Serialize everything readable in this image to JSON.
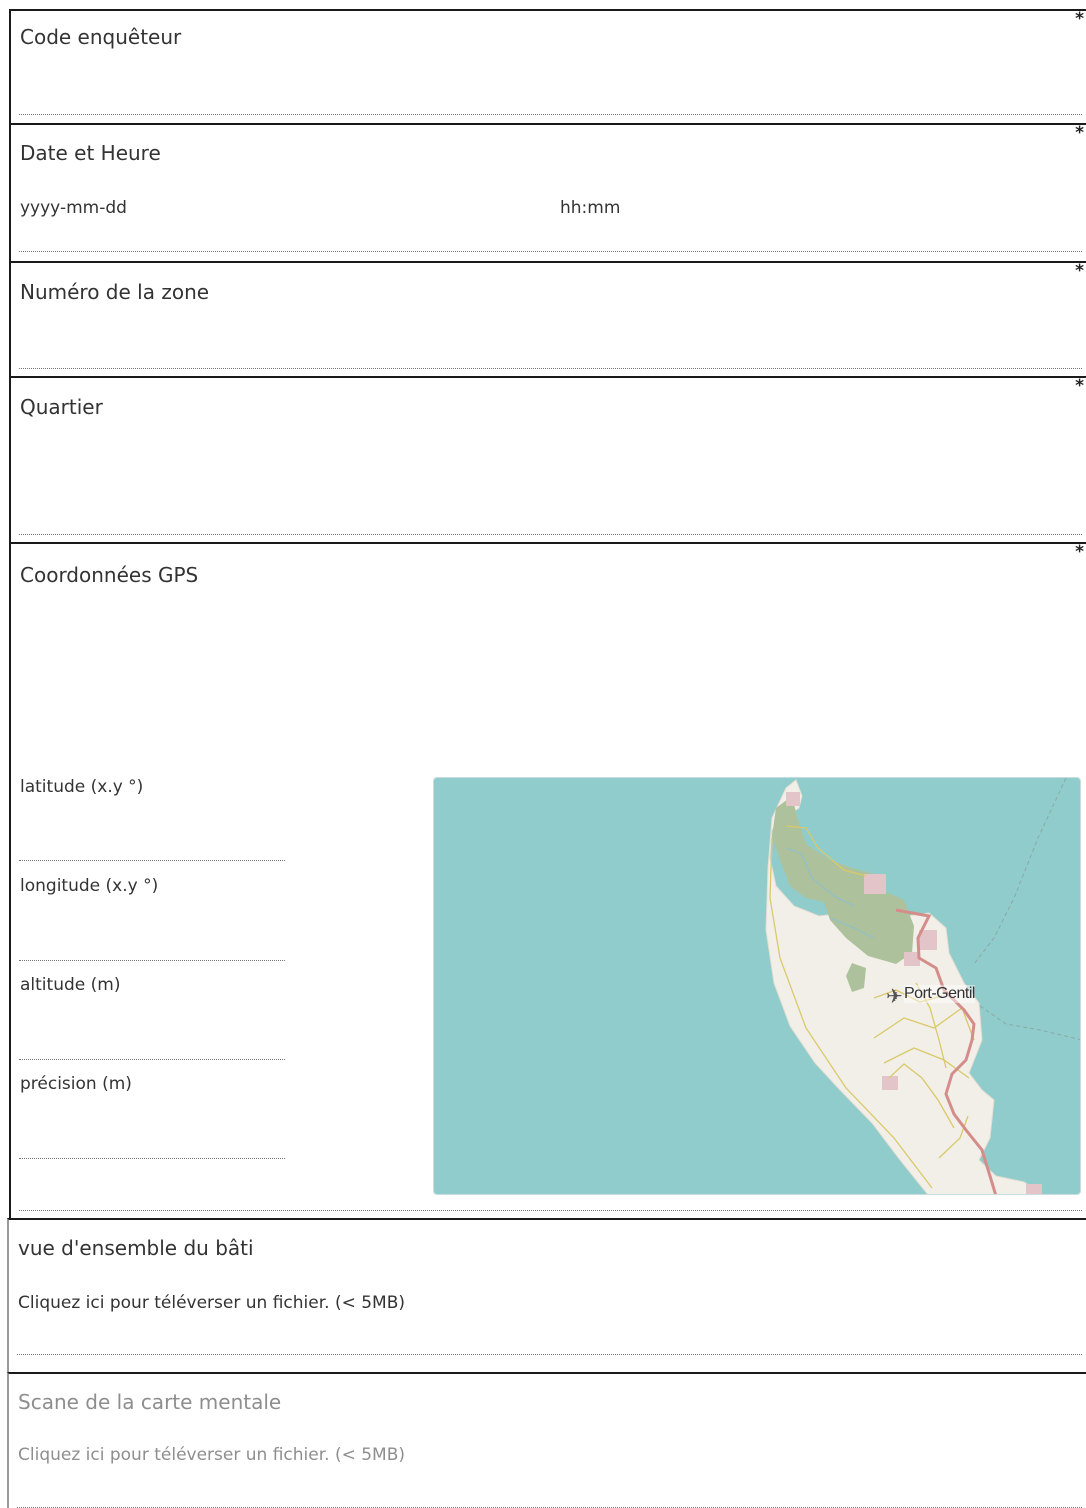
{
  "required_marker": "*",
  "fields": {
    "code_enqueteur": {
      "label": "Code enquêteur"
    },
    "date_heure": {
      "label": "Date et Heure",
      "date_placeholder": "yyyy-mm-dd",
      "time_placeholder": "hh:mm"
    },
    "numero_zone": {
      "label": "Numéro de la zone"
    },
    "quartier": {
      "label": "Quartier"
    },
    "gps": {
      "label": "Coordonnées GPS",
      "latitude": "latitude (x.y °)",
      "longitude": "longitude (x.y °)",
      "altitude": "altitude (m)",
      "precision": "précision (m)",
      "map_place": "Port-Gentil"
    },
    "vue_ensemble": {
      "label": "vue d'ensemble du bâti",
      "upload": "Cliquez ici pour téléverser un fichier. (< 5MB)"
    },
    "carte_mentale": {
      "label": "Scane de la carte mentale",
      "upload": "Cliquez ici pour téléverser un fichier. (< 5MB)"
    }
  },
  "colors": {
    "water": "#90cccb",
    "land": "#f2efe9",
    "forest": "#adc29c",
    "road": "#d9c96a",
    "main_road": "#d58d8a"
  }
}
